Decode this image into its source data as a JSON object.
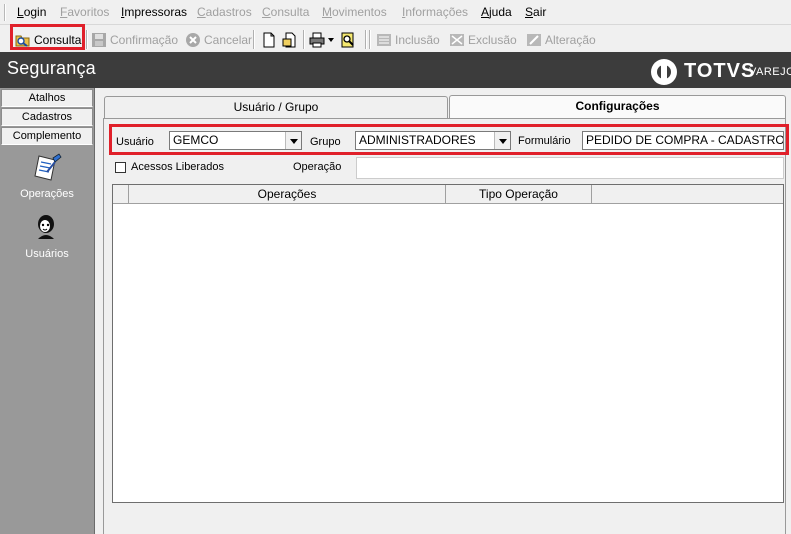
{
  "menu": {
    "items": [
      {
        "label": "Login",
        "enabled": true
      },
      {
        "label": "Favoritos",
        "enabled": false
      },
      {
        "label": "Impressoras",
        "enabled": true
      },
      {
        "label": "Cadastros",
        "enabled": false
      },
      {
        "label": "Consulta",
        "enabled": false
      },
      {
        "label": "Movimentos",
        "enabled": false
      },
      {
        "label": "Informações",
        "enabled": false
      },
      {
        "label": "Ajuda",
        "enabled": true
      },
      {
        "label": "Sair",
        "enabled": true
      }
    ]
  },
  "toolbar": {
    "consulta": {
      "label": "Consulta",
      "icon": "search-folder-icon",
      "enabled": true
    },
    "confirmacao": {
      "label": "Confirmação",
      "icon": "floppy-disk-icon",
      "enabled": false
    },
    "cancelar": {
      "label": "Cancelar",
      "icon": "cancel-circle-icon",
      "enabled": false
    },
    "inclusao": {
      "label": "Inclusão",
      "icon": "add-record-icon",
      "enabled": false
    },
    "exclusao": {
      "label": "Exclusão",
      "icon": "delete-record-icon",
      "enabled": false
    },
    "alteracao": {
      "label": "Alteração",
      "icon": "edit-record-icon",
      "enabled": false
    }
  },
  "header": {
    "title": "Segurança",
    "brand": "TOTVS",
    "brand_sub": "VAREJO",
    "background": "#3c3c3c"
  },
  "sidebar": {
    "tabs": [
      "Atalhos",
      "Cadastros",
      "Complemento"
    ],
    "items": [
      {
        "label": "Operações",
        "icon": "operations-icon"
      },
      {
        "label": "Usuários",
        "icon": "user-icon"
      }
    ],
    "background": "#999999"
  },
  "tabs": [
    {
      "label": "Usuário  / Grupo",
      "active": false
    },
    {
      "label": "Configurações",
      "active": true
    }
  ],
  "filters": {
    "usuario_label": "Usuário",
    "usuario_value": "GEMCO",
    "grupo_label": "Grupo",
    "grupo_value": "ADMINISTRADORES",
    "formulario_label": "Formulário",
    "formulario_value": "PEDIDO DE COMPRA - CADASTRO",
    "acessos_label": "Acessos Liberados",
    "acessos_checked": false,
    "operacao_label": "Operação",
    "operacao_value": ""
  },
  "grid": {
    "columns": [
      "Operações",
      "Tipo Operação"
    ],
    "rows": []
  },
  "highlight_color": "#e0202a"
}
